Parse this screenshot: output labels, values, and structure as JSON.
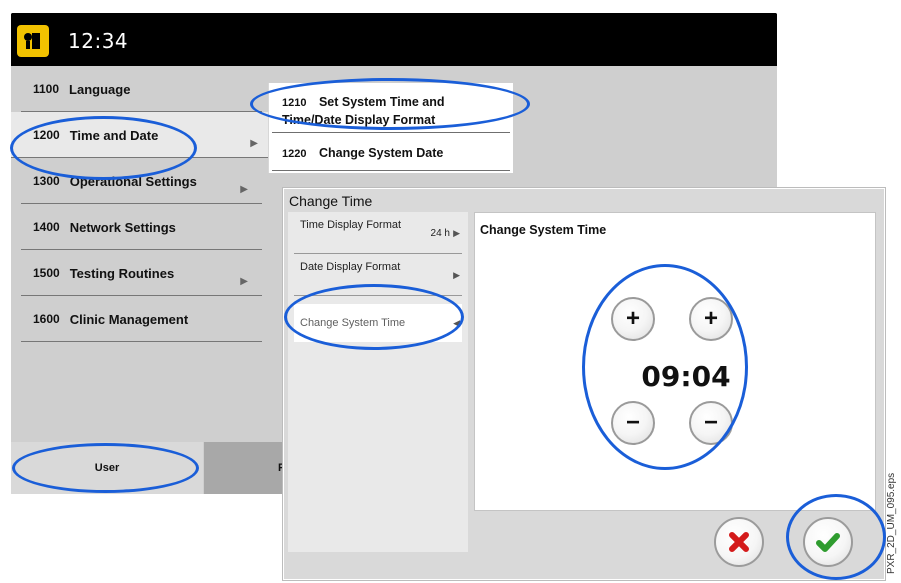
{
  "header": {
    "time": "12:34",
    "app_icon": "reader-icon"
  },
  "menu": {
    "items": [
      {
        "num": "1100",
        "label": "Language"
      },
      {
        "num": "1200",
        "label": "Time and Date"
      },
      {
        "num": "1300",
        "label": "Operational Settings"
      },
      {
        "num": "1400",
        "label": "Network Settings"
      },
      {
        "num": "1500",
        "label": "Testing Routines"
      },
      {
        "num": "1600",
        "label": "Clinic Management"
      }
    ]
  },
  "submenu": {
    "items": [
      {
        "num": "1210",
        "label": "Set System Time and Time/Date Display Format"
      },
      {
        "num": "1220",
        "label": "Change System Date"
      }
    ]
  },
  "bottom_tabs": {
    "user": "User",
    "second": "P"
  },
  "dialog": {
    "title": "Change Time",
    "left_items": [
      {
        "label": "Time Display Format",
        "value": "24 h"
      },
      {
        "label": "Date Display Format",
        "value": ""
      },
      {
        "label": "Change System Time",
        "value": ""
      }
    ],
    "main_title": "Change System Time",
    "time_value": "09:04",
    "plus_label": "+",
    "minus_label": "−"
  },
  "side_caption": "PXR_2D_UM_095.eps",
  "colors": {
    "annotation": "#1a5ed8",
    "cancel": "#d41b1b",
    "confirm": "#2f9c2f"
  }
}
